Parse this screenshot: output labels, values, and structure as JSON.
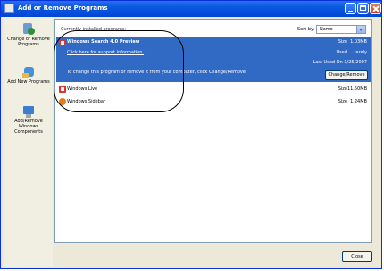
{
  "window": {
    "title": "Add or Remove Programs"
  },
  "sidebar": {
    "items": [
      {
        "icon": "change-remove-programs-icon",
        "label": "Change or Remove Programs"
      },
      {
        "icon": "add-new-programs-icon",
        "label": "Add New Programs"
      },
      {
        "icon": "add-remove-windows-components-icon",
        "label": "Add/Remove Windows Components"
      }
    ]
  },
  "main": {
    "header_text": "Currently installed programs:",
    "sort_label": "Sort by:",
    "sort_value": "Name"
  },
  "programs": {
    "selected": {
      "name": "Windows Search 4.0 Preview",
      "link": "Click here for support information.",
      "description": "To change this program or remove it from your computer, click Change/Remove.",
      "size_label": "Size",
      "size_value": "1.03MB",
      "used_label": "Used",
      "used_value": "rarely",
      "last_used": "Last Used On 3/25/2007",
      "button_label": "Change/Remove"
    },
    "others": [
      {
        "name": "Windows Live",
        "size_label": "Size",
        "size_value": "11.50MB"
      },
      {
        "name": "Windows Sidebar",
        "size_label": "Size",
        "size_value": "1.24MB"
      }
    ]
  },
  "footer": {
    "close_label": "Close"
  },
  "colors": {
    "title_bar": "#0046d5",
    "selection": "#316ac5",
    "annotation": "#000000"
  }
}
